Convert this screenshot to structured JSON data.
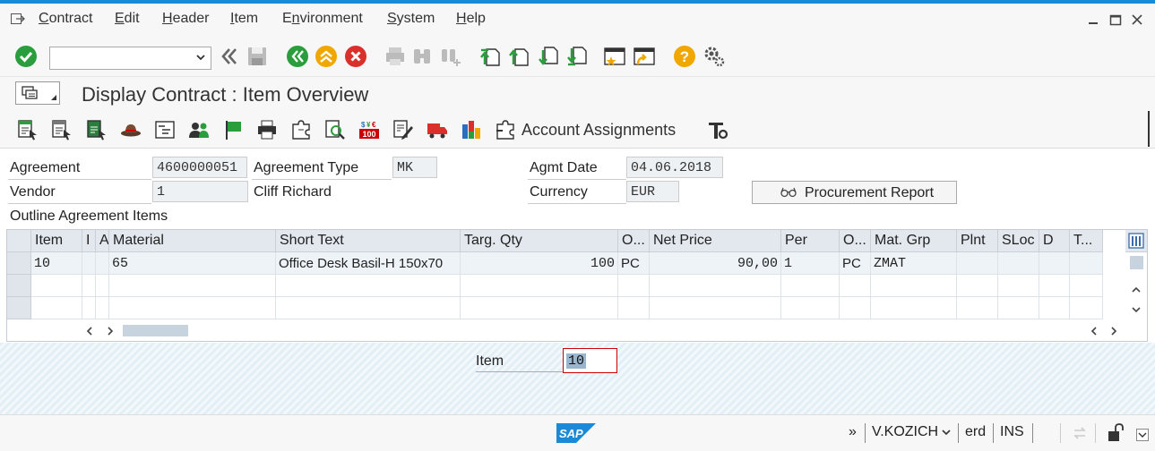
{
  "menu": {
    "items": [
      {
        "label": "Contract",
        "ul": "C"
      },
      {
        "label": "Edit",
        "ul": "E"
      },
      {
        "label": "Header",
        "ul": "H"
      },
      {
        "label": "Item",
        "ul": "I"
      },
      {
        "label": "Environment",
        "ul": "n"
      },
      {
        "label": "System",
        "ul": "S"
      },
      {
        "label": "Help",
        "ul": "H"
      }
    ]
  },
  "toolbar": {
    "command_field_value": ""
  },
  "title": "Display Contract : Item Overview",
  "app_toolbar": {
    "account_assignments_label": "Account Assignments"
  },
  "header": {
    "agreement_label": "Agreement",
    "agreement_value": "4600000051",
    "agreement_type_label": "Agreement Type",
    "agreement_type_value": "MK",
    "agmt_date_label": "Agmt Date",
    "agmt_date_value": "04.06.2018",
    "vendor_label": "Vendor",
    "vendor_value": "1",
    "vendor_name": "Cliff Richard",
    "currency_label": "Currency",
    "currency_value": "EUR",
    "procurement_report_label": "Procurement Report"
  },
  "items_section_title": "Outline Agreement Items",
  "grid": {
    "columns": [
      "Item",
      "I",
      "A",
      "Material",
      "Short Text",
      "Targ. Qty",
      "O...",
      "Net Price",
      "Per",
      "O...",
      "Mat. Grp",
      "Plnt",
      "SLoc",
      "D",
      "T..."
    ],
    "rows": [
      [
        "10",
        "",
        "",
        "65",
        "Office Desk Basil-H 150x70",
        "100",
        "PC",
        "90,00",
        "1",
        "PC",
        "ZMAT",
        "",
        "",
        "",
        ""
      ]
    ]
  },
  "item_field": {
    "label": "Item",
    "value": "10"
  },
  "status": {
    "user": "V.KOZICH",
    "system": "erd",
    "mode": "INS",
    "expand": "»"
  },
  "colors": {
    "accent": "#1b8ad6",
    "ok_green": "#2a9d3c",
    "cancel_red": "#d9302c",
    "help_yellow": "#f0a800"
  }
}
